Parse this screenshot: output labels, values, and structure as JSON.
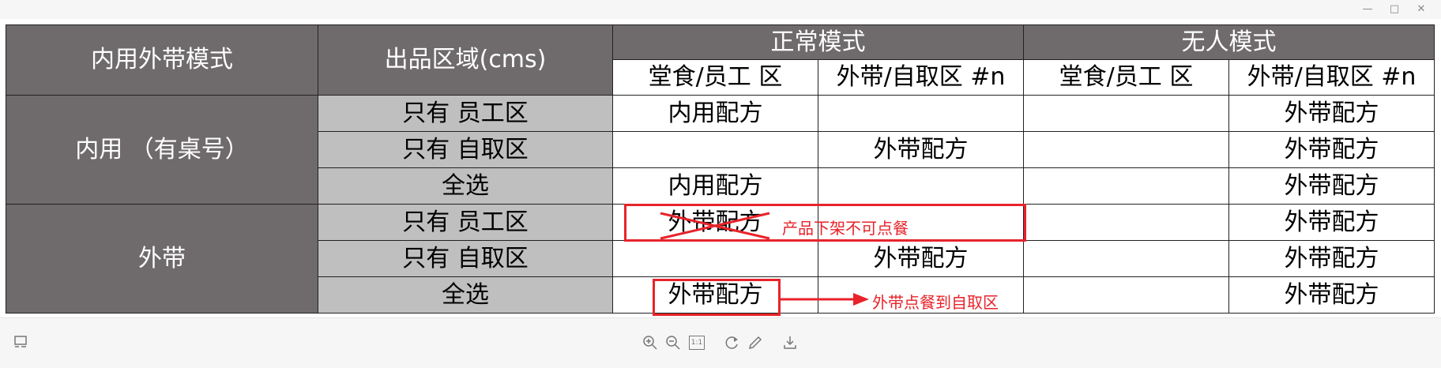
{
  "window": {
    "controls": [
      "—",
      "□",
      "✕"
    ]
  },
  "table": {
    "header": {
      "mode_label": "内用外带模式",
      "area_label": "出品区域(cms)",
      "normal_mode": "正常模式",
      "unmanned_mode": "无人模式",
      "normal_dinein": "堂食/员工 区",
      "normal_takeout": "外带/自取区 #n",
      "unmanned_dinein": "堂食/员工 区",
      "unmanned_takeout": "外带/自取区 #n"
    },
    "groups": [
      {
        "label": "内用 （有桌号）",
        "rows": [
          {
            "area": "只有 员工区",
            "normal_dinein": "内用配方",
            "normal_takeout": "",
            "unmanned_dinein": "",
            "unmanned_takeout": "外带配方"
          },
          {
            "area": "只有 自取区",
            "normal_dinein": "",
            "normal_takeout": "外带配方",
            "unmanned_dinein": "",
            "unmanned_takeout": "外带配方"
          },
          {
            "area": "全选",
            "normal_dinein": "内用配方",
            "normal_takeout": "",
            "unmanned_dinein": "",
            "unmanned_takeout": "外带配方"
          }
        ]
      },
      {
        "label": "外带",
        "rows": [
          {
            "area": "只有 员工区",
            "normal_dinein": "外带配方",
            "normal_takeout": "",
            "unmanned_dinein": "",
            "unmanned_takeout": "外带配方"
          },
          {
            "area": "只有 自取区",
            "normal_dinein": "",
            "normal_takeout": "外带配方",
            "unmanned_dinein": "",
            "unmanned_takeout": "外带配方"
          },
          {
            "area": "全选",
            "normal_dinein": "外带配方",
            "normal_takeout": "",
            "unmanned_dinein": "",
            "unmanned_takeout": "外带配方"
          }
        ]
      }
    ]
  },
  "annotations": {
    "note1": "产品下架不可点餐",
    "note2": "外带点餐到自取区",
    "color": "#e8232a"
  },
  "toolbar": {
    "icons": [
      "panel-toggle-icon",
      "zoom-in-icon",
      "zoom-out-icon",
      "actual-size-icon",
      "rotate-icon",
      "edit-icon",
      "download-icon"
    ],
    "actual_size_label": "1:1"
  }
}
